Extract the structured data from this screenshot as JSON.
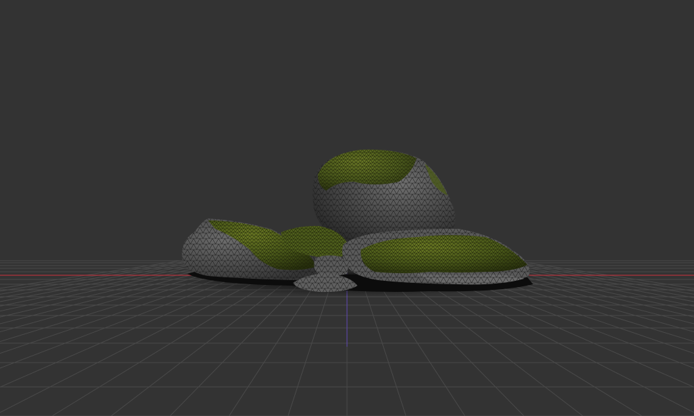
{
  "viewport": {
    "background": "#333333",
    "grid_color": "#4a4a4a",
    "x_axis_color": "#b0323c",
    "z_axis_color": "#5a46a0",
    "shadow_color": "#0d0d0d"
  },
  "model": {
    "rock_colors": {
      "stone_light": "#6e6e6e",
      "stone_mid": "#575757",
      "stone_dark": "#3c3c3c",
      "moss_dark": "#2f3a12",
      "moss_mid": "#4b5a1a",
      "moss_light": "#6b7a24",
      "wire": "#1c1c1c"
    },
    "display_mode": "wireframe-on-shaded"
  }
}
